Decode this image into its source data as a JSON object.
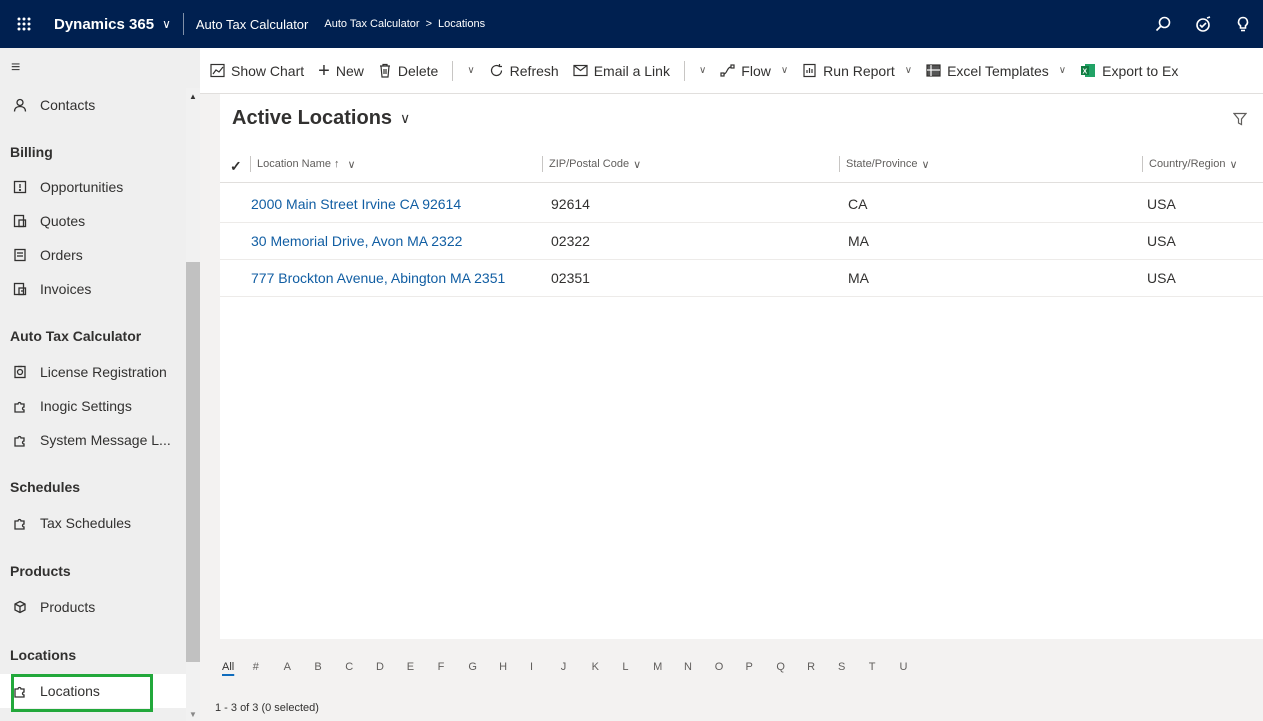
{
  "topbar": {
    "app_name": "Dynamics 365",
    "app_title": "Auto Tax Calculator",
    "breadcrumb": [
      "Auto Tax Calculator",
      "Locations"
    ]
  },
  "sidebar": {
    "items_top": [
      {
        "label": "Contacts",
        "icon": "person-icon"
      }
    ],
    "groups": [
      {
        "title": "Billing",
        "items": [
          {
            "label": "Opportunities",
            "icon": "opportunity-icon"
          },
          {
            "label": "Quotes",
            "icon": "quote-icon"
          },
          {
            "label": "Orders",
            "icon": "order-icon"
          },
          {
            "label": "Invoices",
            "icon": "invoice-icon"
          }
        ]
      },
      {
        "title": "Auto Tax Calculator",
        "items": [
          {
            "label": "License Registration",
            "icon": "license-icon"
          },
          {
            "label": "Inogic Settings",
            "icon": "puzzle-icon"
          },
          {
            "label": "System Message L...",
            "icon": "puzzle-icon"
          }
        ]
      },
      {
        "title": "Schedules",
        "items": [
          {
            "label": "Tax Schedules",
            "icon": "puzzle-icon"
          }
        ]
      },
      {
        "title": "Products",
        "items": [
          {
            "label": "Products",
            "icon": "product-icon"
          }
        ]
      },
      {
        "title": "Locations",
        "items": [
          {
            "label": "Locations",
            "icon": "puzzle-icon",
            "selected": true
          }
        ]
      }
    ]
  },
  "commands": {
    "show_chart": "Show Chart",
    "new": "New",
    "delete": "Delete",
    "refresh": "Refresh",
    "email_link": "Email a Link",
    "flow": "Flow",
    "run_report": "Run Report",
    "excel_templates": "Excel Templates",
    "export": "Export to Ex"
  },
  "view": {
    "title": "Active Locations",
    "columns": [
      "Location Name ↑",
      "ZIP/Postal Code",
      "State/Province",
      "Country/Region"
    ],
    "rows": [
      [
        "2000 Main Street Irvine CA 92614",
        "92614",
        "CA",
        "USA"
      ],
      [
        "30 Memorial Drive, Avon MA 2322",
        "02322",
        "MA",
        "USA"
      ],
      [
        "777 Brockton Avenue, Abington MA 2351",
        "02351",
        "MA",
        "USA"
      ]
    ],
    "alpha": [
      "All",
      "#",
      "A",
      "B",
      "C",
      "D",
      "E",
      "F",
      "G",
      "H",
      "I",
      "J",
      "K",
      "L",
      "M",
      "N",
      "O",
      "P",
      "Q",
      "R",
      "S",
      "T",
      "U"
    ],
    "status": "1 - 3 of 3 (0 selected)"
  },
  "colors": {
    "topbar": "#002050",
    "link": "#115ea3",
    "highlight": "#22a83b"
  }
}
